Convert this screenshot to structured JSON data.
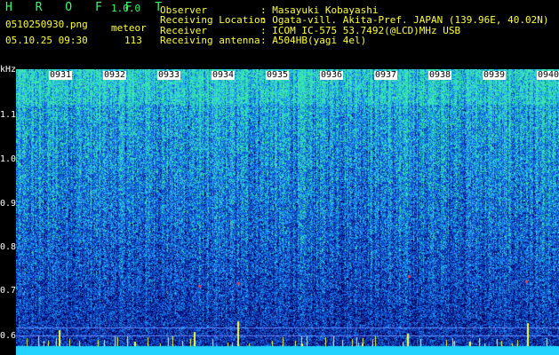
{
  "app": {
    "name": "H R O F F T",
    "version": "1.0.0",
    "filename": "0510250930.png",
    "mode": "meteor",
    "datetime": "05.10.25 09:30",
    "count": "113"
  },
  "station": {
    "observer_label": "Observer",
    "observer_value": ": Masayuki Kobayashi",
    "location_label": "Receiving Location",
    "location_value": ": Ogata-vill. Akita-Pref. JAPAN (139.96E, 40.02N)",
    "receiver_label": "Receiver",
    "receiver_value": ": ICOM IC-575 53.7492(@LCD)MHz USB",
    "antenna_label": "Receiving antenna",
    "antenna_value": ": A504HB(yagi 4el)"
  },
  "spectrogram": {
    "y_unit": "kHz",
    "y_ticks": [
      "1.1",
      "1.0",
      "0.9",
      "0.8",
      "0.7",
      "0.6"
    ],
    "time_ticks": [
      "0931",
      "0932",
      "0933",
      "0934",
      "0935",
      "0936",
      "0937",
      "0938",
      "0939",
      "0940"
    ],
    "colors": {
      "background": "#000000",
      "noise_low": "#10208a",
      "noise_mid": "#2a6cff",
      "noise_high": "#35e8a8",
      "meteor": "#ffff33",
      "band": "#22d3ff"
    }
  }
}
